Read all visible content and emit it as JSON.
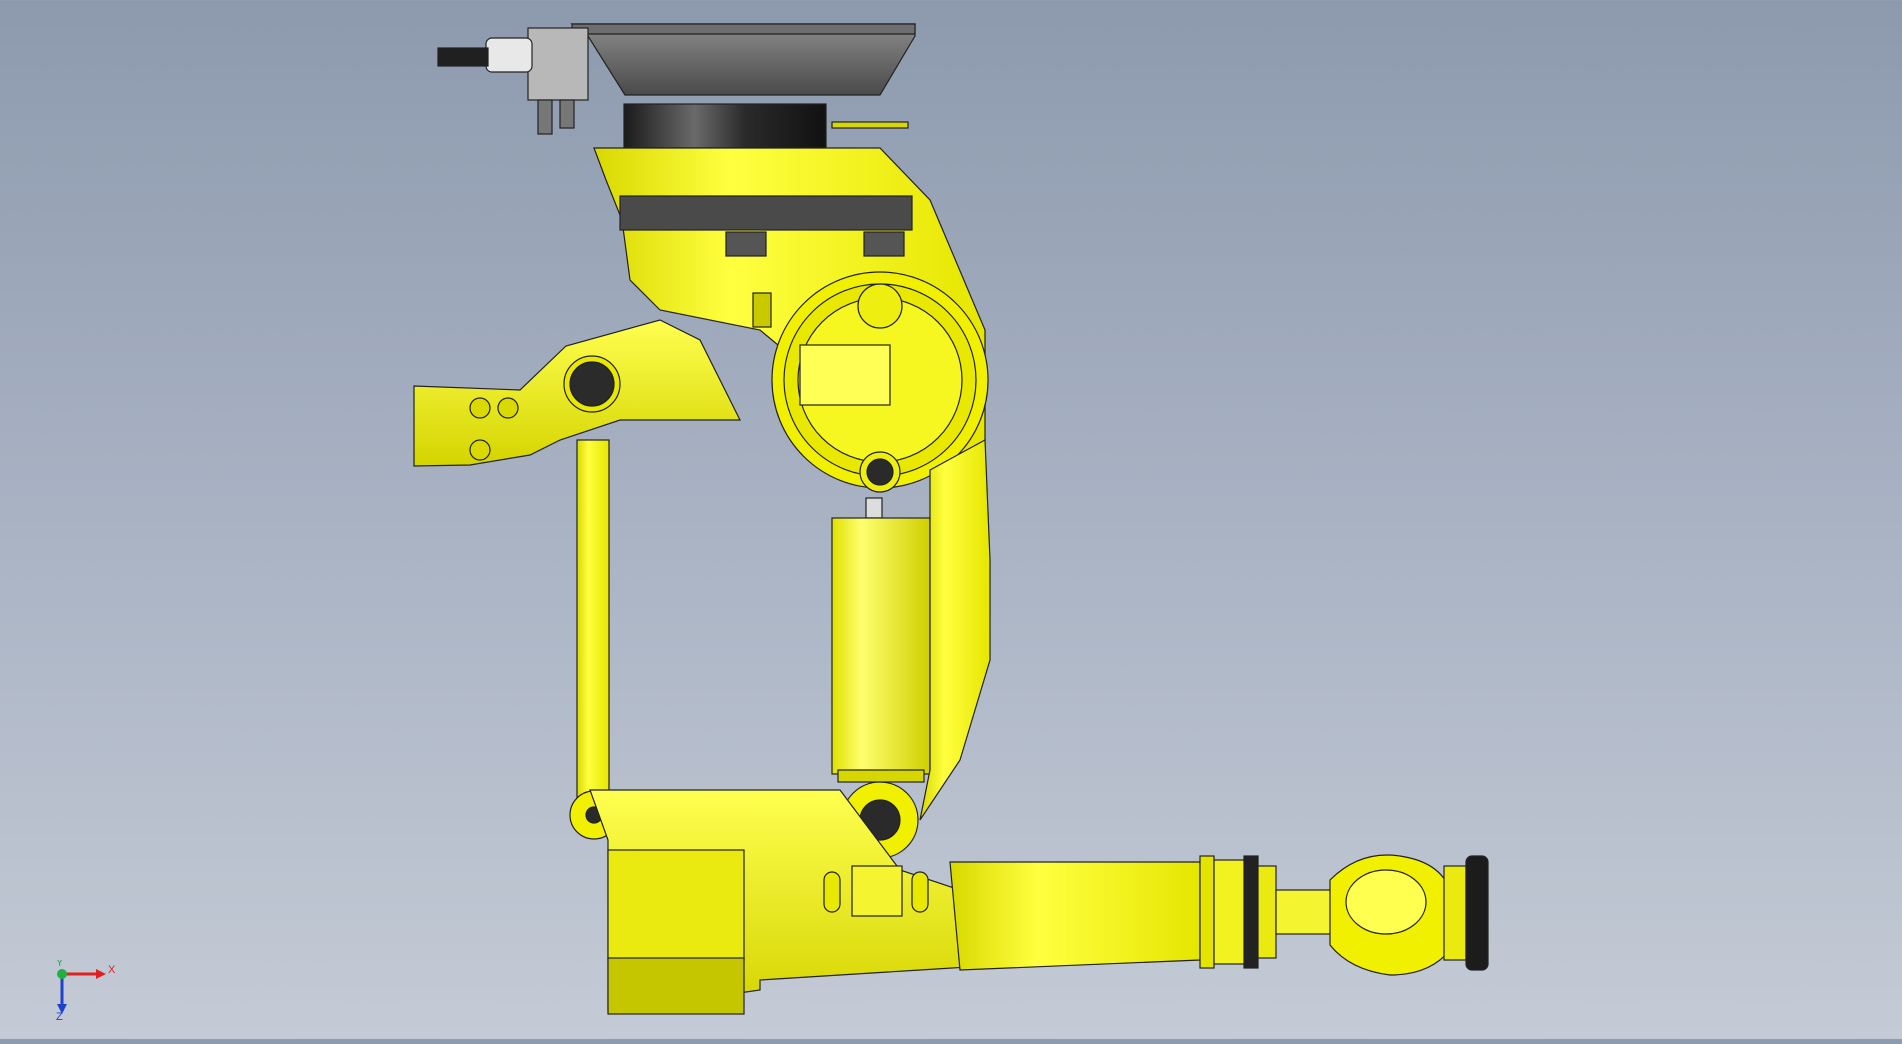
{
  "viewport": {
    "scene": "robot-arm-model",
    "colors": {
      "background_top": "#8d9aae",
      "background_bottom": "#c4cbd6",
      "robot_body": "#f2f200",
      "robot_shadow": "#c9c900",
      "robot_highlight": "#ffff66",
      "mount_plate": "#5a5a5a",
      "flange_dark": "#1c1c1c",
      "outline": "#222222"
    }
  },
  "triad": {
    "x_label": "X",
    "y_label": "Y",
    "z_label": "Z",
    "x_color": "#e02020",
    "y_color": "#20b040",
    "z_color": "#2040d0"
  }
}
